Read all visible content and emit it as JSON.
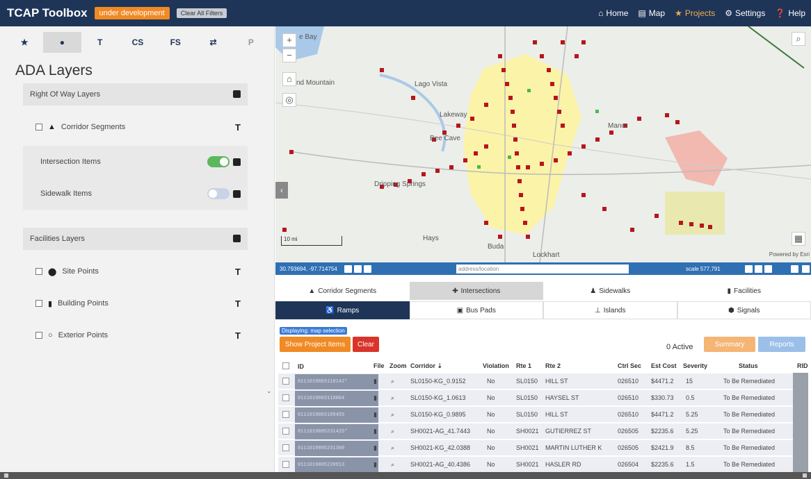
{
  "app": {
    "brand": "TCAP Toolbox",
    "dev_badge": "under development",
    "clear_filters": "Clear All Filters",
    "nav": [
      {
        "label": "Home",
        "icon": "home-icon"
      },
      {
        "label": "Map",
        "icon": "map-icon"
      },
      {
        "label": "Projects",
        "icon": "star-icon"
      },
      {
        "label": "Settings",
        "icon": "gear-icon"
      },
      {
        "label": "Help",
        "icon": "help-icon"
      }
    ]
  },
  "sidebar": {
    "tabs": [
      {
        "glyph": "★",
        "name": "favorites"
      },
      {
        "glyph": "●",
        "name": "layers"
      },
      {
        "glyph": "T",
        "name": "filter"
      },
      {
        "glyph": "CS",
        "name": "cs"
      },
      {
        "glyph": "FS",
        "name": "fs"
      },
      {
        "glyph": "⇄",
        "name": "swap"
      },
      {
        "glyph": "P",
        "name": "p"
      }
    ],
    "title": "ADA Layers",
    "row_section_title": "Right Of Way Layers",
    "corridor_segments": "Corridor Segments",
    "intersection_items": "Intersection Items",
    "sidewalk_items": "Sidewalk Items",
    "facilities_section_title": "Facilities Layers",
    "site_points": "Site Points",
    "building_points": "Building Points",
    "exterior_points": "Exterior Points",
    "toggles": {
      "intersection_items": "on",
      "sidewalk_items": "off"
    }
  },
  "map": {
    "labels": [
      {
        "text": "Lago Vista",
        "name": "label-lago-vista"
      },
      {
        "text": "nd Mountain",
        "name": "label-mountain"
      },
      {
        "text": "Lakeway",
        "name": "label-lakeway"
      },
      {
        "text": "Bee Cave",
        "name": "label-bee-cave"
      },
      {
        "text": "Dripping Springs",
        "name": "label-dripping-springs"
      },
      {
        "text": "Hays",
        "name": "label-hays"
      },
      {
        "text": "e Bay",
        "name": "label-bay"
      },
      {
        "text": "Manor",
        "name": "label-manor"
      },
      {
        "text": "Buda",
        "name": "label-buda"
      },
      {
        "text": "Lockhart",
        "name": "label-lockhart"
      }
    ],
    "scale_text": "10 mi",
    "powered_by": "Powered by Esri",
    "coords": "30.793694, -97.714754",
    "address_placeholder": "address/location",
    "scale_readout": "scale 577,791",
    "colors": {
      "marker": "#b8141c",
      "urban": "#fbf3a8",
      "water": "#aac9e8",
      "route": "#ffffff"
    }
  },
  "layer_tabs": [
    {
      "label": "Corridor Segments",
      "icon": "road-icon"
    },
    {
      "label": "Intersections",
      "icon": "intersection-icon"
    },
    {
      "label": "Sidewalks",
      "icon": "pedestrian-icon"
    },
    {
      "label": "Facilities",
      "icon": "building-icon"
    }
  ],
  "sub_tabs": [
    {
      "label": "Ramps",
      "icon": "ramp-icon"
    },
    {
      "label": "Bus Pads",
      "icon": "bus-icon"
    },
    {
      "label": "Islands",
      "icon": "island-icon"
    },
    {
      "label": "Signals",
      "icon": "signal-icon"
    }
  ],
  "actions": {
    "displaying": "Displaying: map selection",
    "show_project_items": "Show Project Items",
    "clear": "Clear",
    "active_count": "0 Active",
    "summary": "Summary",
    "reports": "Reports"
  },
  "table": {
    "columns": [
      "ID",
      "File",
      "Zoom",
      "Corridor ⇣",
      "Violation",
      "Rte 1",
      "Rte 2",
      "Ctrl Sec",
      "Est Cost",
      "Severity",
      "Status",
      "RID"
    ],
    "rows": [
      {
        "id": "0111019003110142*",
        "corridor": "SL0150-KG_0.9152",
        "violation": "No",
        "rte1": "SL0150",
        "rte2": "HILL ST",
        "ctrl": "026510",
        "cost": "$4471.2",
        "severity": "15",
        "status": "To Be Remediated"
      },
      {
        "id": "0111019003110004",
        "corridor": "SL0150-KG_1.0613",
        "violation": "No",
        "rte1": "SL0150",
        "rte2": "HAYSEL ST",
        "ctrl": "026510",
        "cost": "$330.73",
        "severity": "0.5",
        "status": "To Be Remediated"
      },
      {
        "id": "0111019003109455",
        "corridor": "SL0150-KG_0.9895",
        "violation": "No",
        "rte1": "SL0150",
        "rte2": "HILL ST",
        "ctrl": "026510",
        "cost": "$4471.2",
        "severity": "5.25",
        "status": "To Be Remediated"
      },
      {
        "id": "0111019005231425*",
        "corridor": "SH0021-AG_41.7443",
        "violation": "No",
        "rte1": "SH0021",
        "rte2": "GUTIERREZ ST",
        "ctrl": "026505",
        "cost": "$2235.6",
        "severity": "5.25",
        "status": "To Be Remediated"
      },
      {
        "id": "0111019005231300",
        "corridor": "SH0021-KG_42.0388",
        "violation": "No",
        "rte1": "SH0021",
        "rte2": "MARTIN LUTHER K",
        "ctrl": "026505",
        "cost": "$2421.9",
        "severity": "8.5",
        "status": "To Be Remediated"
      },
      {
        "id": "0111019005220913",
        "corridor": "SH0021-AG_40.4386",
        "violation": "No",
        "rte1": "SH0021",
        "rte2": "HASLER RD",
        "ctrl": "026504",
        "cost": "$2235.6",
        "severity": "1.5",
        "status": "To Be Remediated"
      }
    ]
  }
}
